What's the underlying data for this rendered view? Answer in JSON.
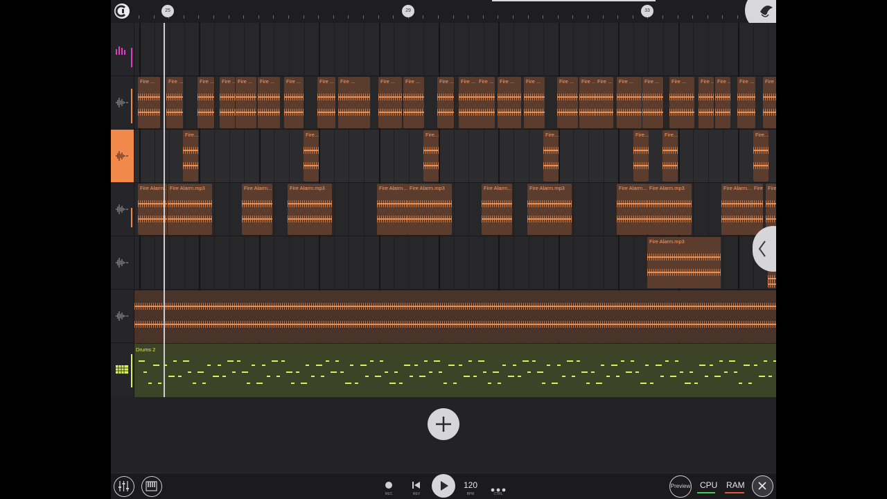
{
  "ruler": {
    "markers": [
      "25",
      "29",
      "33"
    ]
  },
  "tracks": [
    {
      "type": "automation",
      "icon": "equalizer-icon"
    },
    {
      "type": "audio",
      "icon": "waveform-icon",
      "clip_label": "Fire ..."
    },
    {
      "type": "audio",
      "icon": "waveform-icon",
      "clip_label": "Fire...",
      "selected": true
    },
    {
      "type": "audio",
      "icon": "waveform-icon",
      "clip_label": "Fire Alarm.mp3",
      "clip_label_short": "Fire Alarm...",
      "clip_label_tiny": "Fire..."
    },
    {
      "type": "audio",
      "icon": "waveform-icon",
      "clip_label": "Fire Alarm.mp3"
    },
    {
      "type": "audio",
      "icon": "waveform-icon"
    },
    {
      "type": "drums",
      "icon": "pads-icon",
      "clip_label": "Drums 2"
    }
  ],
  "transport": {
    "rec_label": "REC",
    "rev_label": "REV",
    "bpm_value": "120",
    "bpm_label": "BPM",
    "ctrl_label": "CTRL",
    "preview_label": "Preview",
    "cpu_label": "CPU",
    "ram_label": "RAM"
  },
  "colors": {
    "accent": "#f0894a",
    "clip_bg": "#5b3c2d",
    "drums": "#d9f25c",
    "automation": "#e03cc8",
    "cpu_meter": "#3fcf55",
    "ram_meter": "#e6573c"
  }
}
